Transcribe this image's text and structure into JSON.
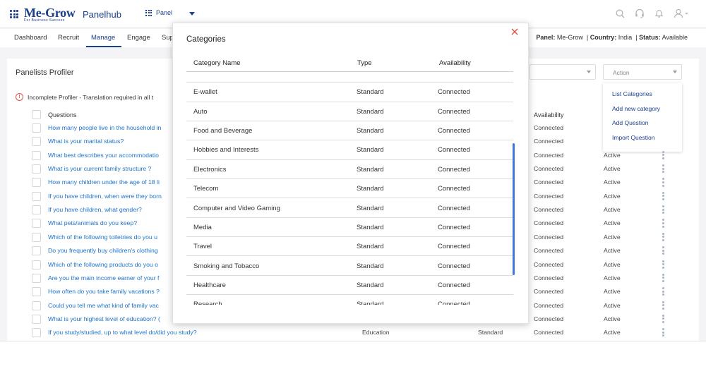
{
  "header": {
    "logo_main": "Me-Grow",
    "logo_sub": "For Business Success",
    "app_name": "Panelhub",
    "panel_switch_label": "Panel"
  },
  "subnav": {
    "items": [
      {
        "label": "Dashboard"
      },
      {
        "label": "Recruit"
      },
      {
        "label": "Manage"
      },
      {
        "label": "Engage"
      },
      {
        "label": "Sup"
      }
    ],
    "panel_key": "Panel:",
    "panel_val": "Me-Grow",
    "country_key": "Country:",
    "country_val": "India",
    "status_key": "Status:",
    "status_val": "Available"
  },
  "profiler": {
    "title": "Panelists Profiler",
    "warning": "Incomplete Profiler - Translation required in all t",
    "action_label": "Action",
    "action_menu": [
      "List Categories",
      "Add new category",
      "Add Question",
      "Import Question"
    ],
    "col_questions": "Questions",
    "col_availability": "Availability",
    "rows": [
      {
        "q": "How many people live in the household in",
        "availability": "Connected",
        "status": ""
      },
      {
        "q": "What is your marital status?",
        "availability": "Connected",
        "status": ""
      },
      {
        "q": "What best describes your accommodatio",
        "availability": "Connected",
        "status": "Active"
      },
      {
        "q": "What is your current family structure ?",
        "availability": "Connected",
        "status": "Active"
      },
      {
        "q": "How many children under the age of 18 li",
        "availability": "Connected",
        "status": "Active"
      },
      {
        "q": "If you have children, when were they born",
        "availability": "Connected",
        "status": "Active"
      },
      {
        "q": "If you have children, what gender?",
        "availability": "Connected",
        "status": "Active"
      },
      {
        "q": "What pets/animals do you keep?",
        "availability": "Connected",
        "status": "Active"
      },
      {
        "q": "Which of the following toiletries do you u",
        "availability": "Connected",
        "status": "Active"
      },
      {
        "q": "Do you frequently buy children's clothing",
        "availability": "Connected",
        "status": "Active"
      },
      {
        "q": "Which of the following products do you o",
        "availability": "Connected",
        "status": "Active"
      },
      {
        "q": "Are you the main income earner of your f",
        "availability": "Connected",
        "status": "Active"
      },
      {
        "q": "How often do you take family vacations ?",
        "availability": "Connected",
        "status": "Active"
      },
      {
        "q": "Could you tell me what kind of family vac",
        "availability": "Connected",
        "status": "Active"
      },
      {
        "q": "What is your highest level of education? (",
        "availability": "Connected",
        "status": "Active"
      },
      {
        "q": "If you study/studied, up to what level do/did you study?",
        "category": "Education",
        "type": "Standard",
        "availability": "Connected",
        "status": "Active"
      }
    ]
  },
  "modal": {
    "title": "Categories",
    "col_name": "Category Name",
    "col_type": "Type",
    "col_availability": "Availability",
    "rows": [
      {
        "name": "E-wallet",
        "type": "Standard",
        "availability": "Connected"
      },
      {
        "name": "Auto",
        "type": "Standard",
        "availability": "Connected"
      },
      {
        "name": "Food and Beverage",
        "type": "Standard",
        "availability": "Connected"
      },
      {
        "name": "Hobbies and Interests",
        "type": "Standard",
        "availability": "Connected"
      },
      {
        "name": "Electronics",
        "type": "Standard",
        "availability": "Connected"
      },
      {
        "name": "Telecom",
        "type": "Standard",
        "availability": "Connected"
      },
      {
        "name": "Computer and Video Gaming",
        "type": "Standard",
        "availability": "Connected"
      },
      {
        "name": "Media",
        "type": "Standard",
        "availability": "Connected"
      },
      {
        "name": "Travel",
        "type": "Standard",
        "availability": "Connected"
      },
      {
        "name": "Smoking and Tobacco",
        "type": "Standard",
        "availability": "Connected"
      },
      {
        "name": "Healthcare",
        "type": "Standard",
        "availability": "Connected"
      },
      {
        "name": "Research",
        "type": "Standard",
        "availability": "Connected"
      }
    ]
  },
  "colors": {
    "brand": "#1c3f8c",
    "link": "#1c73c9",
    "close": "#e0483e",
    "scrollbar": "#3c78e0"
  },
  "icons": [
    "apps-grid-icon",
    "search-icon",
    "headset-icon",
    "bell-icon",
    "user-icon",
    "close-icon",
    "warning-icon",
    "kebab-menu-icon"
  ]
}
